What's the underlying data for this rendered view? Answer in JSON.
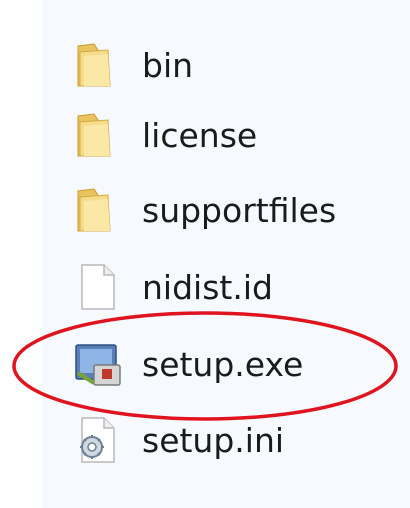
{
  "file_list": {
    "items": [
      {
        "name": "bin",
        "icon": "folder-icon"
      },
      {
        "name": "license",
        "icon": "folder-icon"
      },
      {
        "name": "supportfiles",
        "icon": "folder-icon"
      },
      {
        "name": "nidist.id",
        "icon": "blank-file-icon"
      },
      {
        "name": "setup.exe",
        "icon": "installer-icon"
      },
      {
        "name": "setup.ini",
        "icon": "settings-file-icon"
      }
    ]
  },
  "colors": {
    "highlight": "#e0141e",
    "folder": "#f2d175",
    "panel": "#f6f9fd"
  }
}
